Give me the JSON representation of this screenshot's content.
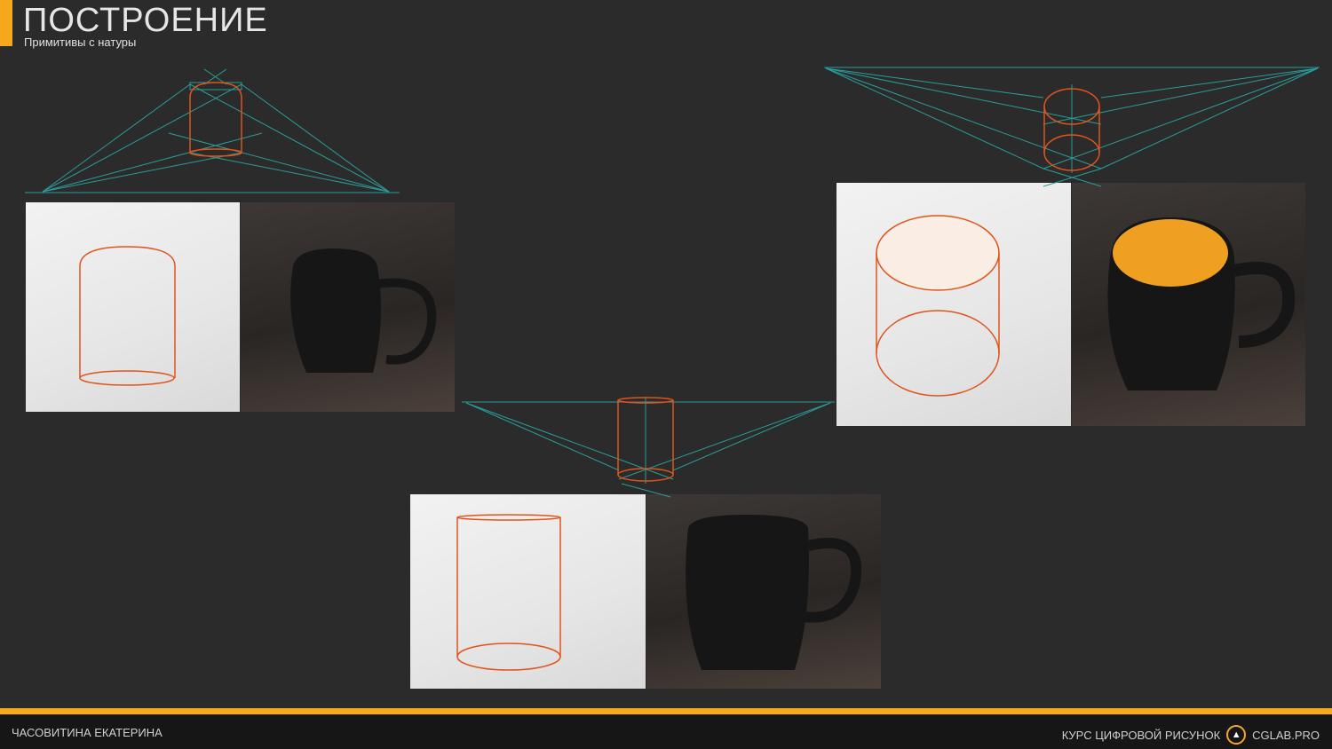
{
  "header": {
    "title": "ПОСТРОЕНИЕ",
    "subtitle": "Примитивы с натуры"
  },
  "footer": {
    "author": "ЧАСОВИТИНА ЕКАТЕРИНА",
    "course": "КУРС ЦИФРОВОЙ РИСУНОК",
    "site": "CGLAB.PRO",
    "logo_icon": "triangle-logo-icon"
  },
  "colors": {
    "accent": "#f5a81c",
    "construction": "#2a9d9a",
    "primitive": "#e0541c",
    "background": "#2b2b2b"
  }
}
